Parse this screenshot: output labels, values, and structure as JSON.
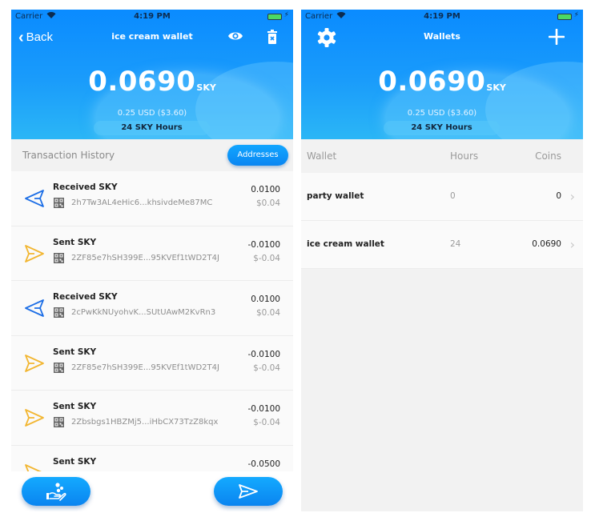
{
  "status_bar": {
    "carrier": "Carrier",
    "time": "4:19 PM"
  },
  "wallet_detail": {
    "nav": {
      "back_label": "Back",
      "title": "ice cream wallet",
      "icons": [
        "back-chevron-icon",
        "eye-icon",
        "trash-icon"
      ]
    },
    "balance": {
      "amount": "0.0690",
      "unit": "SKY",
      "usd": "0.25 USD ($3.60)",
      "hours": "24 SKY Hours"
    },
    "section_title": "Transaction History",
    "addresses_button": "Addresses",
    "colors": {
      "received": "#1e6fe6",
      "sent": "#f2b632",
      "accent": "#0a8bff"
    },
    "transactions": [
      {
        "type": "Received SKY",
        "direction": "received",
        "address": "2h7Tw3AL4eHic6...khsivdeMe87MC",
        "amount": "0.0100",
        "fiat": "$0.04"
      },
      {
        "type": "Sent SKY",
        "direction": "sent",
        "address": "2ZF85e7hSH399E...95KVEf1tWD2T4J",
        "amount": "-0.0100",
        "fiat": "$-0.04"
      },
      {
        "type": "Received SKY",
        "direction": "received",
        "address": "2cPwKkNUyohvK...SUtUAwM2KvRn3",
        "amount": "0.0100",
        "fiat": "$0.04"
      },
      {
        "type": "Sent SKY",
        "direction": "sent",
        "address": "2ZF85e7hSH399E...95KVEf1tWD2T4J",
        "amount": "-0.0100",
        "fiat": "$-0.04"
      },
      {
        "type": "Sent SKY",
        "direction": "sent",
        "address": "2Zbsbgs1HBZMj5...iHbCX73TzZ8kqx",
        "amount": "-0.0100",
        "fiat": "$-0.04"
      },
      {
        "type": "Sent SKY",
        "direction": "sent",
        "address": "",
        "amount": "-0.0500",
        "fiat": ""
      }
    ],
    "bottom_buttons": [
      "receive-hand-icon",
      "send-icon"
    ]
  },
  "wallets": {
    "nav": {
      "title": "Wallets",
      "icons": [
        "gear-icon",
        "plus-icon"
      ]
    },
    "balance": {
      "amount": "0.0690",
      "unit": "SKY",
      "usd": "0.25 USD ($3.60)",
      "hours": "24 SKY Hours"
    },
    "columns": [
      "Wallet",
      "Hours",
      "Coins"
    ],
    "rows": [
      {
        "name": "party wallet",
        "hours": "0",
        "coins": "0"
      },
      {
        "name": "ice cream wallet",
        "hours": "24",
        "coins": "0.0690"
      }
    ]
  }
}
